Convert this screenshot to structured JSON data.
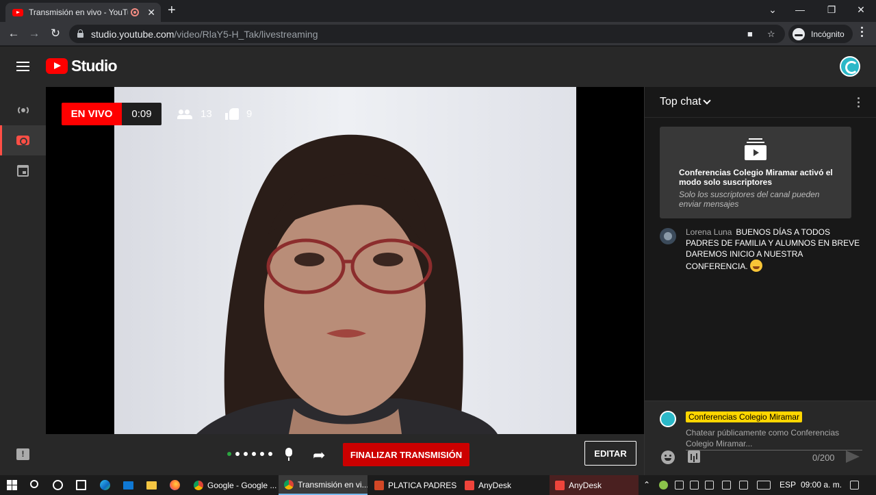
{
  "browser": {
    "tab_title": "Transmisión en vivo - YouTube Studio",
    "tab_close": "✕",
    "new_tab": "+",
    "url_host": "studio.youtube.com",
    "url_path": "/video/RlaY5-H_Tak/livestreaming",
    "incognito_label": "Incógnito",
    "window_controls": {
      "collapse": "⌄",
      "minimize": "—",
      "restore": "❐",
      "close": "✕"
    },
    "nav": {
      "back": "←",
      "forward": "→",
      "reload": "↻"
    }
  },
  "studio": {
    "logo_text": "Studio"
  },
  "stream": {
    "live_label": "EN VIVO",
    "elapsed": "0:09",
    "viewers": "13",
    "likes": "9"
  },
  "controls": {
    "end_stream_label": "FINALIZAR TRANSMISIÓN",
    "edit_label": "EDITAR",
    "share_glyph": "➦"
  },
  "chat": {
    "title": "Top chat",
    "notice_title": "Conferencias Colegio Miramar activó el modo solo suscriptores",
    "notice_subtitle": "Solo los suscriptores del canal pueden enviar mensajes",
    "messages": [
      {
        "author": "Lorena Luna",
        "text": "BUENOS DÍAS A TODOS PADRES DE FAMILIA Y ALUMNOS EN BREVE DAREMOS INICIO A NUESTRA CONFERENCIA."
      }
    ],
    "composer_name": "Conferencias Colegio Miramar",
    "composer_placeholder": "Chatear públicamente como Conferencias Colegio Miramar...",
    "char_count": "0/200"
  },
  "taskbar": {
    "apps": [
      {
        "label": "Google - Google ..."
      },
      {
        "label": "Transmisión en vi..."
      },
      {
        "label": "PLATICA PADRES ..."
      },
      {
        "label": "AnyDesk"
      },
      {
        "label": "AnyDesk"
      }
    ],
    "language": "ESP",
    "time": "09:00 a. m.",
    "tray_chevron": "⌃"
  },
  "colors": {
    "youtube_red": "#ff0000",
    "end_button": "#cc0000",
    "author_highlight": "#ffd600",
    "active_rail": "#ff4e45"
  }
}
